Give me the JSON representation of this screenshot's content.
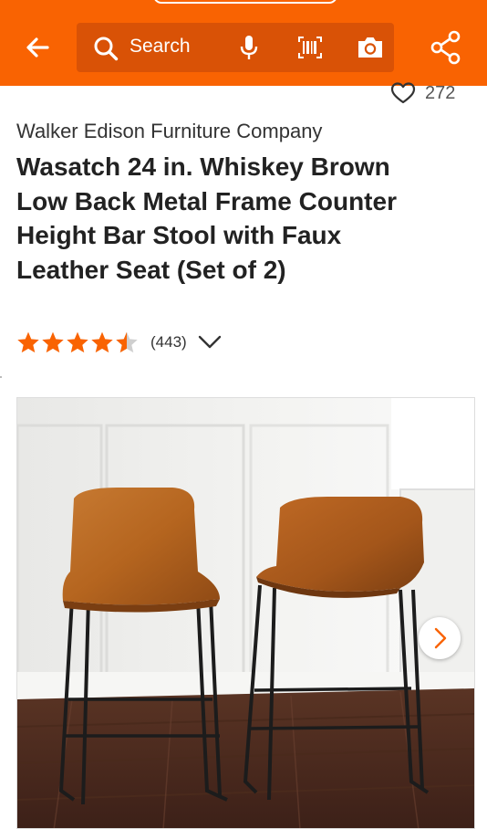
{
  "header": {
    "search_placeholder": "Search",
    "icons": [
      "back-arrow-icon",
      "search-icon",
      "microphone-icon",
      "barcode-icon",
      "camera-icon",
      "share-icon"
    ]
  },
  "favorites": {
    "count": "272",
    "icon": "heart-icon"
  },
  "product": {
    "brand": "Walker Edison Furniture Company",
    "title": "Wasatch 24 in. Whiskey Brown Low Back Metal Frame Counter Height Bar Stool with Faux Leather Seat (Set of 2)",
    "rating": 4.5,
    "review_count": "(443)"
  },
  "colors": {
    "brand_orange": "#f96302",
    "search_bg": "#d95206",
    "star": "#f96302"
  }
}
